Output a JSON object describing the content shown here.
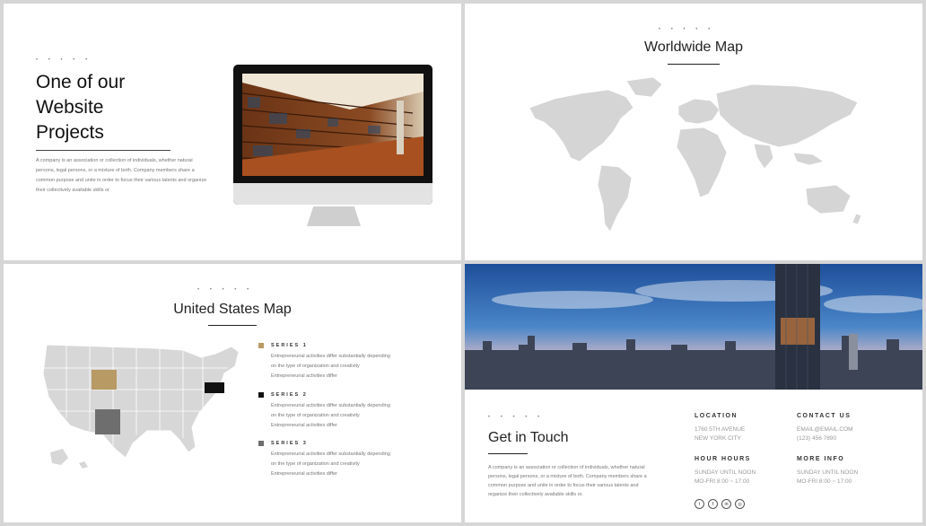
{
  "slide1": {
    "dots": "• • • • •",
    "title_lines": [
      "One of our",
      "Website",
      "Projects"
    ],
    "description": "A company is an association or collection of individuals, whether natural persons, legal persons, or a mixture of both. Company members share a common purpose and unite in order to focus their various talents and organize their collectively available skills or"
  },
  "slide2": {
    "dots": "• • • • •",
    "title": "Worldwide Map"
  },
  "slide3": {
    "dots": "• • • • •",
    "title": "United States Map",
    "series": [
      {
        "label": "SERIES 1",
        "color": "#b89a64",
        "lines": [
          "Entrepreneurial activities differ substantially depending",
          "on the type of organization and creativity",
          "Entrepreneurial activities differ"
        ]
      },
      {
        "label": "SERIES 2",
        "color": "#111111",
        "lines": [
          "Entrepreneurial activities differ substantially depending",
          "on the type of organization and creativity",
          "Entrepreneurial activities differ"
        ]
      },
      {
        "label": "SERIES 3",
        "color": "#6e6e6e",
        "lines": [
          "Entrepreneurial activities differ substantially depending",
          "on the type of organization and creativity",
          "Entrepreneurial activities differ"
        ]
      }
    ]
  },
  "slide4": {
    "dots": "• • • • •",
    "title": "Get in Touch",
    "description": "A company is an association or collection of individuals, whether natural persons, legal persons, or a mixture of both. Company members share a common purpose and unite in order to focus their various talents and organize their collectively available skills or.",
    "location_label": "LOCATION",
    "location_lines": [
      "1760 5TH AVENUE",
      "NEW YORK CITY"
    ],
    "contact_label": "CONTACT US",
    "contact_lines": [
      "EMAIL@EMAIL.COM",
      "(123) 456 7890"
    ],
    "hours_label": "HOUR HOURS",
    "hours_lines": [
      "SUNDAY UNTIL NOON",
      "MO-FRI 8:00 ~ 17:00"
    ],
    "more_label": "MORE INFO",
    "more_lines": [
      "SUNDAY UNTIL NOON",
      "MO-FRI 8:00 ~ 17:00"
    ],
    "social_icons": [
      "twitter-icon",
      "facebook-icon",
      "linkedin-icon",
      "instagram-icon"
    ],
    "social_glyphs": [
      "t",
      "f",
      "in",
      "◎"
    ]
  }
}
